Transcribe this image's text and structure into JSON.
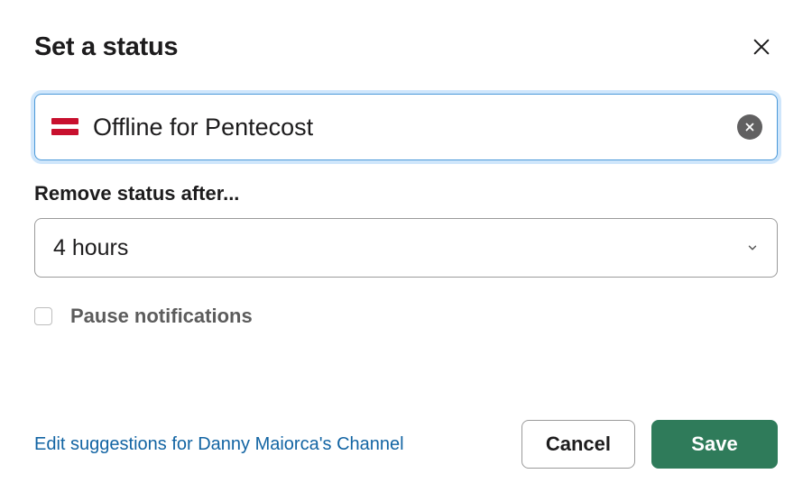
{
  "header": {
    "title": "Set a status"
  },
  "status": {
    "emoji": "flag-dk",
    "text_value": "Offline for Pentecost"
  },
  "duration": {
    "label": "Remove status after...",
    "selected": "4 hours"
  },
  "notifications": {
    "pause_label": "Pause notifications",
    "checked": false
  },
  "footer": {
    "edit_link": "Edit suggestions for Danny Maiorca's Channel",
    "cancel_label": "Cancel",
    "save_label": "Save"
  }
}
